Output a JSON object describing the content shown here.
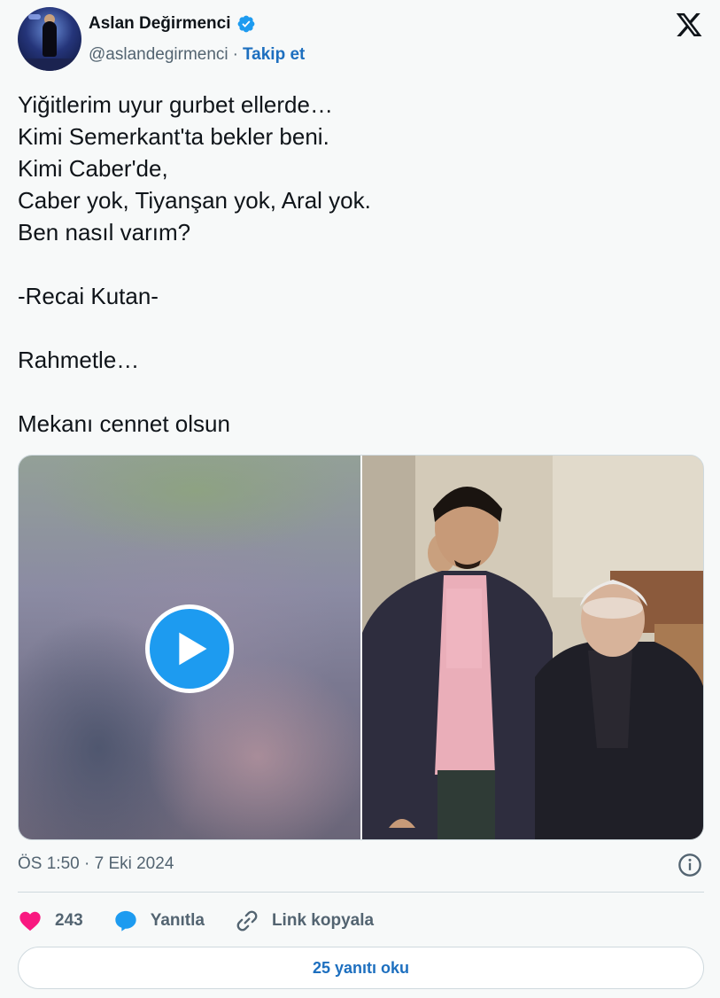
{
  "author": {
    "display_name": "Aslan Değirmenci",
    "handle": "@aslandegirmenci",
    "separator": "·",
    "follow_label": "Takip et",
    "verified": true
  },
  "tweet": {
    "lines": [
      "Yiğitlerim uyur gurbet ellerde…",
      "Kimi Semerkant'ta bekler beni.",
      "Kimi Caber'de,",
      "Caber yok, Tiyanşan yok, Aral yok.",
      "Ben nasıl varım?",
      "",
      "-Recai Kutan-",
      "",
      "Rahmetle…",
      "",
      "Mekanı cennet olsun"
    ]
  },
  "media": {
    "video_icon": "play-icon",
    "photo_icon": "photo"
  },
  "meta": {
    "timestamp": "ÖS 1:50 · 7 Eki 2024"
  },
  "actions": {
    "like_count": "243",
    "reply_label": "Yanıtla",
    "copy_link_label": "Link kopyala"
  },
  "footer": {
    "read_replies_label": "25 yanıtı oku"
  },
  "colors": {
    "accent": "#1d9bf0",
    "link": "#1d6fbf",
    "like": "#f91880",
    "secondary_text": "#536471",
    "background": "#f7f9f9"
  }
}
